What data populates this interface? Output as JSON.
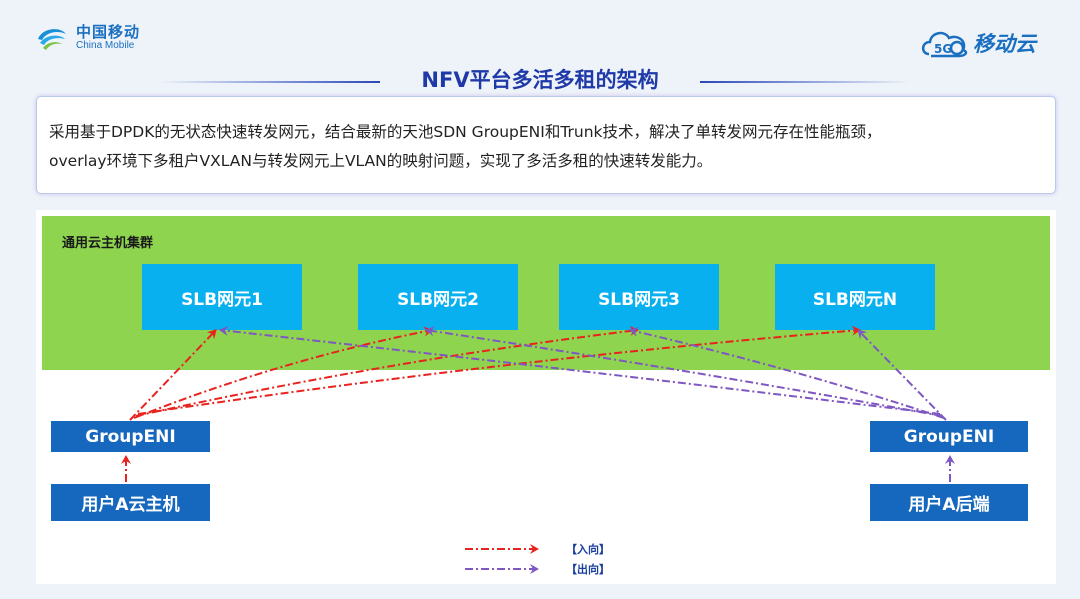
{
  "header": {
    "logo_cn": "中国移动",
    "logo_en": "China Mobile",
    "brand_right": "移动云",
    "brand_right_badge": "5G",
    "title": "NFV平台多活多租的架构"
  },
  "description": {
    "line1": "采用基于DPDK的无状态快速转发网元，结合最新的天池SDN GroupENI和Trunk技术，解决了单转发网元存在性能瓶颈，",
    "line2": "overlay环境下多租户VXLAN与转发网元上VLAN的映射问题，实现了多活多租的快速转发能力。"
  },
  "diagram": {
    "cluster_label": "通用云主机集群",
    "slb_nodes": [
      "SLB网元1",
      "SLB网元2",
      "SLB网元3",
      "SLB网元N"
    ],
    "left_eni": "GroupENI",
    "right_eni": "GroupENI",
    "left_host": "用户A云主机",
    "right_host": "用户A后端",
    "legend_in": "【入向】",
    "legend_out": "【出向】"
  },
  "colors": {
    "inbound": "#e8231f",
    "outbound": "#7e57c2",
    "cluster_bg": "#8ed44f",
    "slb_bg": "#09b0ef",
    "box_bg": "#1668be",
    "title": "#1f3aa8"
  }
}
